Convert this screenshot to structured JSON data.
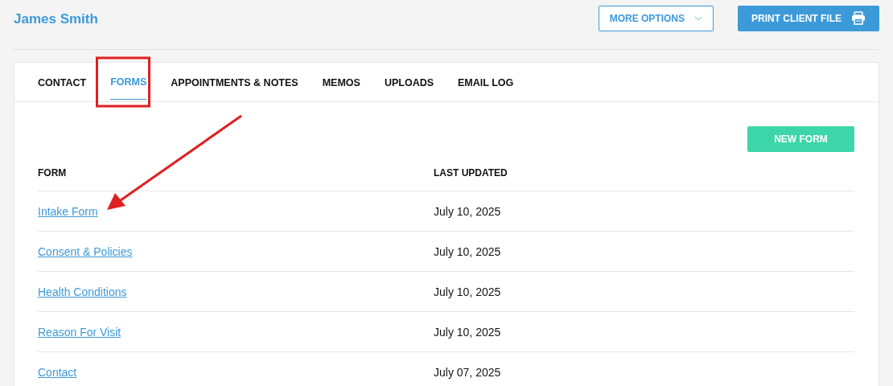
{
  "client_name": "James Smith",
  "header_buttons": [
    {
      "label": "MORE OPTIONS",
      "kind": "dropdown"
    },
    {
      "label": "PRINT CLIENT FILE",
      "kind": "print"
    }
  ],
  "tabs": [
    {
      "label": "CONTACT",
      "selected": false
    },
    {
      "label": "FORMS",
      "selected": true
    },
    {
      "label": "APPOINTMENTS & NOTES",
      "selected": false
    },
    {
      "label": "MEMOS",
      "selected": false
    },
    {
      "label": "UPLOADS",
      "selected": false
    },
    {
      "label": "EMAIL LOG",
      "selected": false
    }
  ],
  "new_form_button": "NEW FORM",
  "table": {
    "columns": [
      "FORM",
      "LAST UPDATED"
    ],
    "rows": [
      {
        "form": "Intake Form",
        "last_updated": "July 10, 2025"
      },
      {
        "form": "Consent & Policies",
        "last_updated": "July 10, 2025"
      },
      {
        "form": "Health Conditions",
        "last_updated": "July 10, 2025"
      },
      {
        "form": "Reason For Visit",
        "last_updated": "July 10, 2025"
      },
      {
        "form": "Contact",
        "last_updated": "July 07, 2025"
      }
    ]
  }
}
